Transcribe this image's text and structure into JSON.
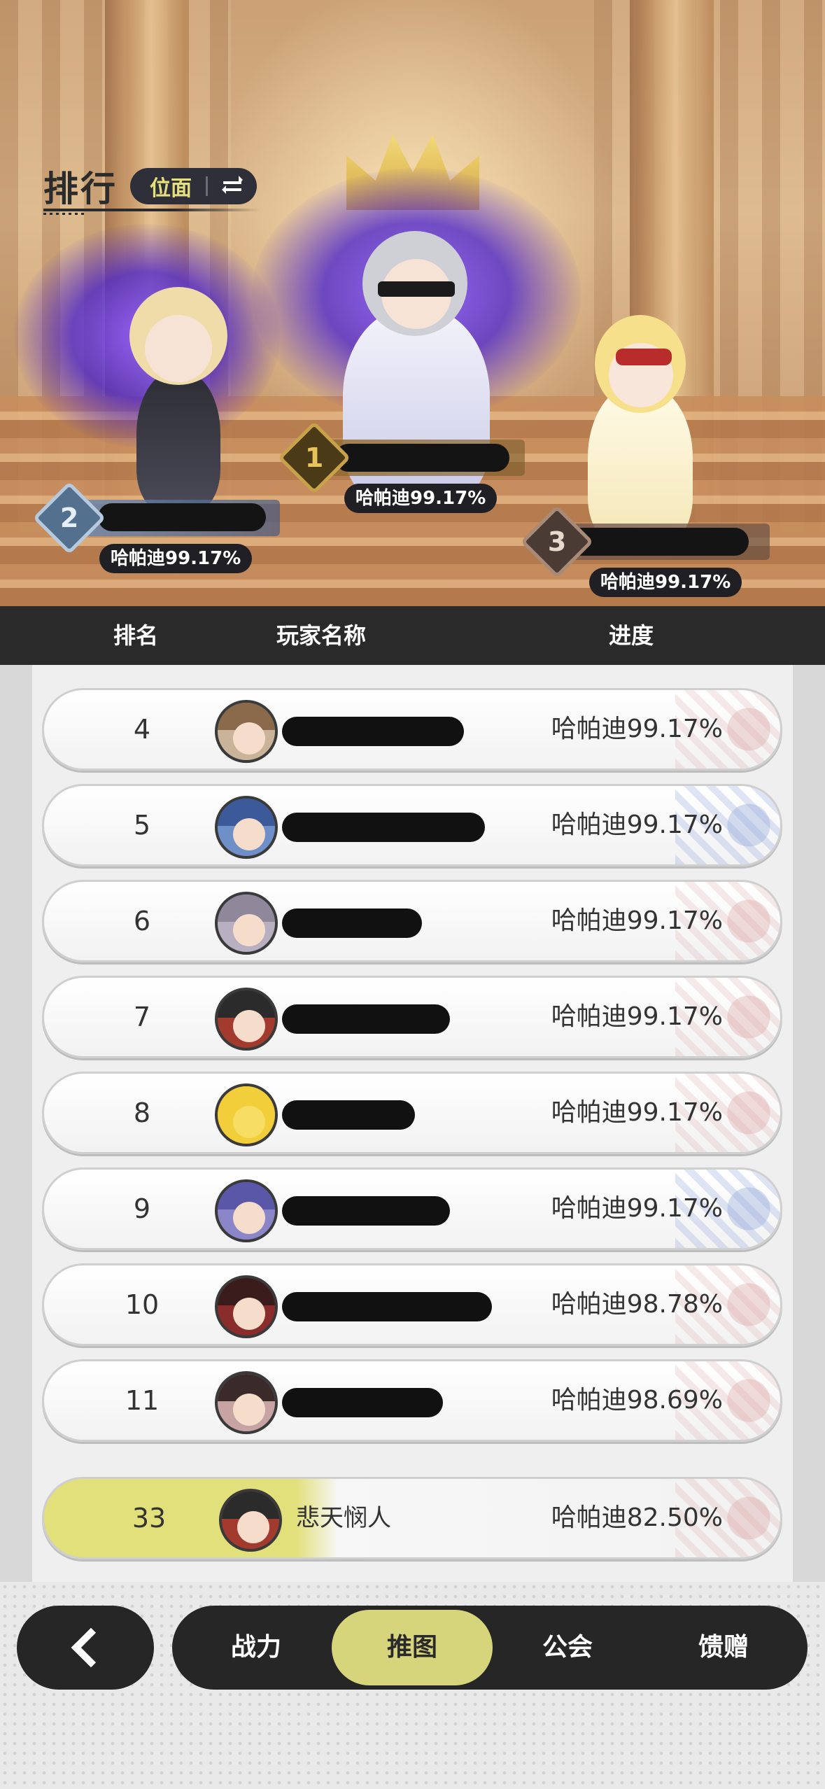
{
  "header": {
    "title": "排行",
    "scope_label": "位面"
  },
  "podium": [
    {
      "rank": "1",
      "progress": "哈帕迪99.17%"
    },
    {
      "rank": "2",
      "progress": "哈帕迪99.17%"
    },
    {
      "rank": "3",
      "progress": "哈帕迪99.17%"
    }
  ],
  "columns": {
    "rank": "排名",
    "player": "玩家名称",
    "progress": "进度"
  },
  "rows": [
    {
      "rank": "4",
      "progress": "哈帕迪99.17%"
    },
    {
      "rank": "5",
      "progress": "哈帕迪99.17%"
    },
    {
      "rank": "6",
      "progress": "哈帕迪99.17%"
    },
    {
      "rank": "7",
      "progress": "哈帕迪99.17%"
    },
    {
      "rank": "8",
      "progress": "哈帕迪99.17%"
    },
    {
      "rank": "9",
      "progress": "哈帕迪99.17%"
    },
    {
      "rank": "10",
      "progress": "哈帕迪98.78%"
    },
    {
      "rank": "11",
      "progress": "哈帕迪98.69%"
    }
  ],
  "self_row": {
    "rank": "33",
    "name": "悲天悯人",
    "progress": "哈帕迪82.50%"
  },
  "tabs": [
    {
      "label": "战力"
    },
    {
      "label": "推图"
    },
    {
      "label": "公会"
    },
    {
      "label": "馈赠"
    }
  ],
  "active_tab": "推图",
  "icons": {
    "back": "chevron-left-icon",
    "swap": "swap-arrows-icon"
  },
  "colors": {
    "accent": "#d7d57c",
    "dark": "#262626",
    "header_bar": "#2a2a2a"
  }
}
